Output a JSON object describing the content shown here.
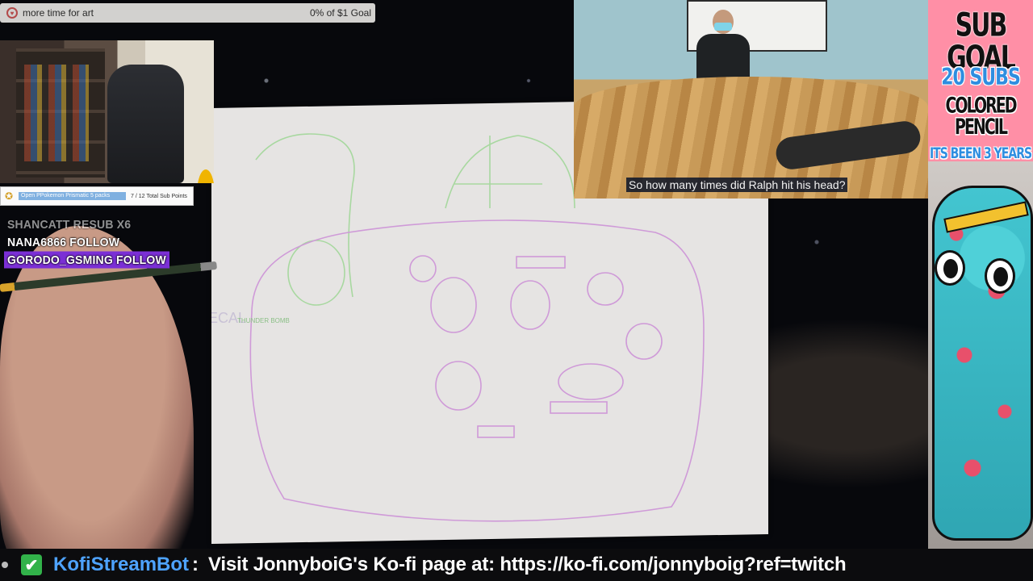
{
  "goal": {
    "title": "more time for art",
    "amount": "0% of $1 Goal",
    "icon": "kofi-cup-icon"
  },
  "sub_points": {
    "task": "Open PPokemon Prismatic 5 packs",
    "progress": "7 / 12 Total Sub Points",
    "icon": "star-badge-icon"
  },
  "events": [
    {
      "user": "SHANCATT",
      "action": "RESUB X6"
    },
    {
      "user": "NANA6866",
      "action": "FOLLOW"
    },
    {
      "user": "GORODO_GSMING",
      "action": "FOLLOW"
    }
  ],
  "video": {
    "caption": "So how many times did Ralph hit his head?"
  },
  "sub_goal": {
    "title": "SUB GOAL",
    "subs": "20 SUBS",
    "reward": "COLORED PENCIL",
    "years": "ITS BEEN 3 YEARS"
  },
  "chat": {
    "user": "KofiStreamBot",
    "separator": ":",
    "message": "Visit JonnyboiG's Ko-fi page at: https://ko-fi.com/jonnyboig?ref=twitch",
    "badge_icon": "check-badge-icon"
  },
  "sketch": {
    "labels": [
      "SPECAL",
      "THUNDER BOMB"
    ]
  },
  "colors": {
    "accent_purple": "#7b2fd6",
    "subgoal_pink": "#ff8fa6",
    "subgoal_blue": "#2f8ee0",
    "chat_user_blue": "#4ea3ff",
    "kofi_green": "#32b24a"
  }
}
